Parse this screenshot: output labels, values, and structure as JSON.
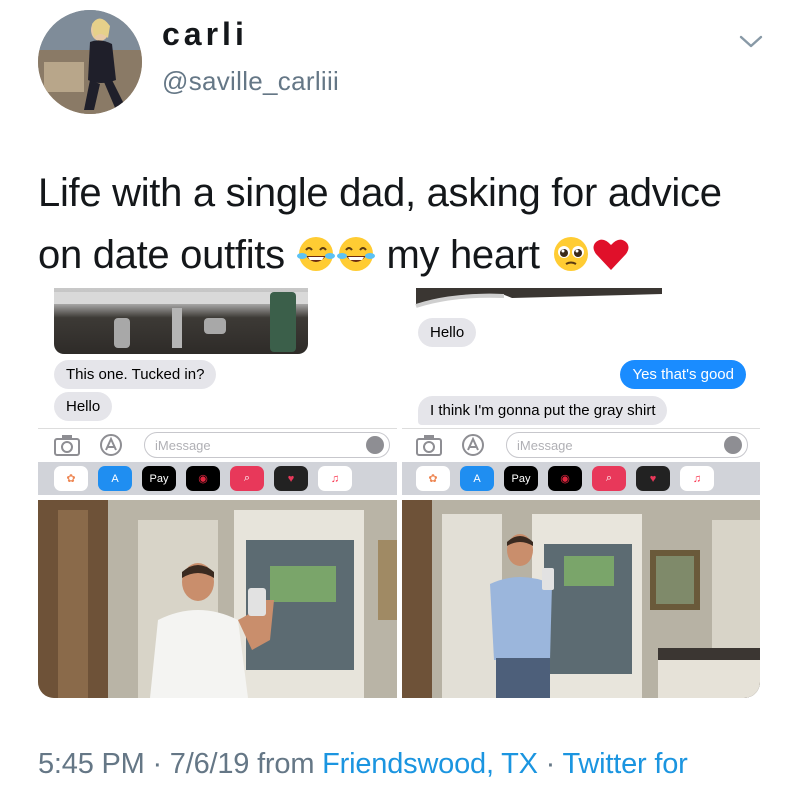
{
  "user": {
    "display_name": "carli",
    "handle": "@saville_carliii"
  },
  "tweet": {
    "line1": "Life with a single dad, asking for advice",
    "line2_start": "on date outfits",
    "line2_middle": "my heart",
    "emojis": [
      "face-with-tears-of-joy-icon",
      "face-with-tears-of-joy-icon",
      "pleading-face-icon",
      "red-heart-icon"
    ]
  },
  "screenshot_left": {
    "messages": [
      {
        "text": "This one. Tucked in?",
        "side": "incoming"
      },
      {
        "text": "Hello",
        "side": "incoming"
      }
    ],
    "input_placeholder": "iMessage"
  },
  "screenshot_right": {
    "messages": [
      {
        "text": "Hello",
        "side": "incoming"
      },
      {
        "text": "Yes that's good",
        "side": "outgoing"
      },
      {
        "text": "I think I'm gonna put the gray shirt",
        "side": "incoming"
      }
    ],
    "input_placeholder": "iMessage"
  },
  "app_bar": {
    "pay_label": "Pay"
  },
  "footer": {
    "time": "5:45 PM",
    "separator": " · ",
    "date": "7/6/19",
    "from_label": " from ",
    "location": "Friendswood, TX",
    "separator2": " · ",
    "source": "Twitter for"
  },
  "colors": {
    "link": "#1b95e0",
    "secondary_text": "#657786",
    "imessage_blue": "#1a8cff",
    "incoming_bubble": "#e5e5ea"
  }
}
